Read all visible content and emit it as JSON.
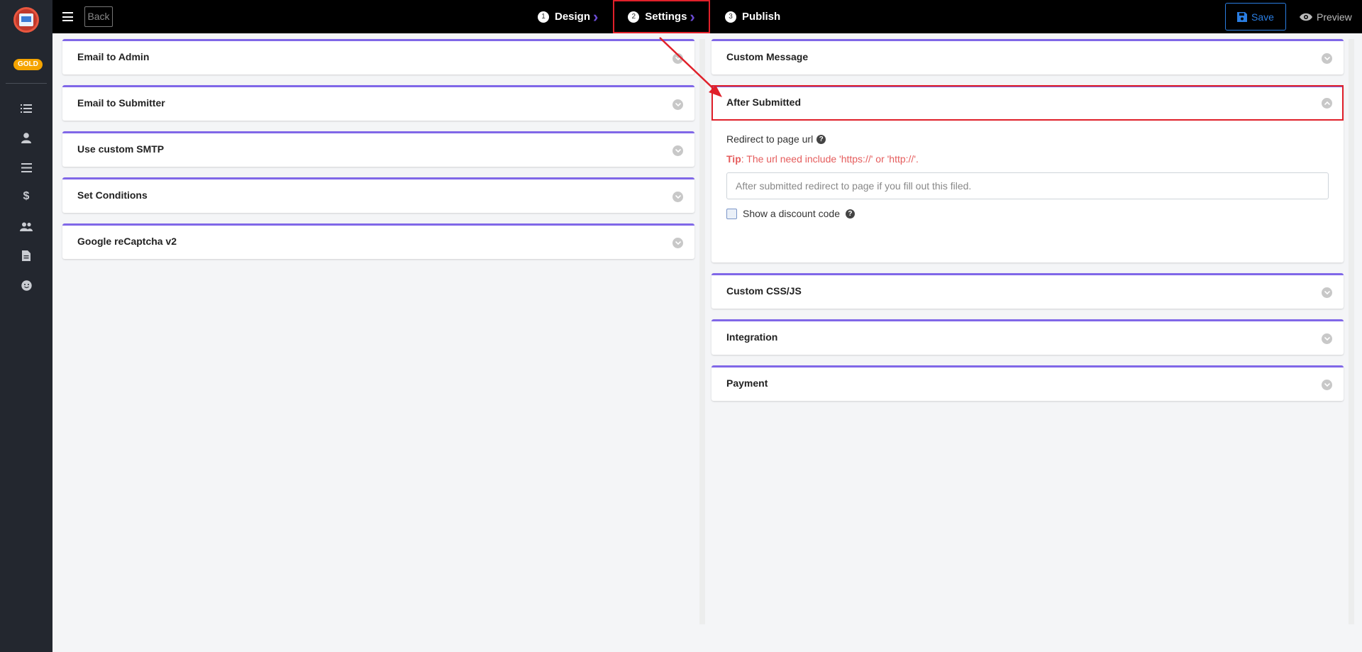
{
  "app": {
    "badge": "GOLD"
  },
  "topbar": {
    "back_label": "Back",
    "steps": [
      {
        "num": "1",
        "label": "Design"
      },
      {
        "num": "2",
        "label": "Settings"
      },
      {
        "num": "3",
        "label": "Publish"
      }
    ],
    "save_label": "Save",
    "preview_label": "Preview"
  },
  "sidebar": {
    "icons": [
      "list-icon",
      "user-icon",
      "menu-icon",
      "dollar-icon",
      "users-icon",
      "document-icon",
      "smile-icon"
    ]
  },
  "left_panels": [
    {
      "title": "Email to Admin"
    },
    {
      "title": "Email to Submitter"
    },
    {
      "title": "Use custom SMTP"
    },
    {
      "title": "Set Conditions"
    },
    {
      "title": "Google reCaptcha v2"
    }
  ],
  "right_panels": {
    "custom_message": "Custom Message",
    "after_submitted": {
      "title": "After Submitted",
      "redirect_label": "Redirect to page url",
      "tip_prefix": "Tip",
      "tip_text": ": The url need include 'https://' or 'http://'.",
      "url_placeholder": "After submitted redirect to page if you fill out this filed.",
      "url_value": "",
      "discount_label": "Show a discount code",
      "discount_checked": false
    },
    "custom_css": "Custom CSS/JS",
    "integration": "Integration",
    "payment": "Payment"
  },
  "colors": {
    "accent": "#8067e8",
    "highlight": "#e0202a",
    "save_blue": "#2a7de1",
    "badge_gold": "#f5a400",
    "tip_red": "#e55c5c"
  }
}
